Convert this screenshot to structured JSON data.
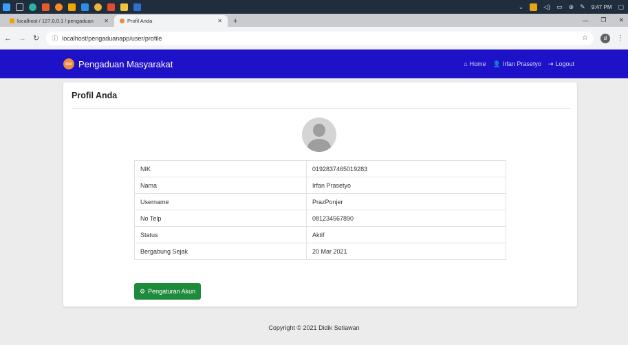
{
  "taskbar": {
    "time": "9:47 PM",
    "icons": [
      "windows-icon",
      "task-view-icon",
      "edge-icon",
      "app-icon",
      "firefox-icon",
      "xampp-icon",
      "vscode-icon",
      "chrome-icon",
      "git-icon",
      "explorer-icon",
      "word-icon"
    ],
    "tray": [
      "chevron-up-icon",
      "app-tray-icon",
      "volume-icon",
      "battery-icon",
      "network-icon",
      "pen-icon"
    ]
  },
  "browser": {
    "tabs": [
      {
        "title": "localhost / 127.0.0.1 / pengaduan",
        "active": false
      },
      {
        "title": "Profil Anda",
        "active": true
      }
    ],
    "url": "localhost/pengaduanapp/user/profile",
    "profile_initial": "d"
  },
  "navbar": {
    "brand": "Pengaduan Masyarakat",
    "links": {
      "home": "Home",
      "user": "Irfan Prasetyo",
      "logout": "Logout"
    },
    "colors": {
      "bg": "#1d12c7"
    }
  },
  "profile": {
    "title": "Profil Anda",
    "rows": [
      {
        "label": "NIK",
        "value": "0192837465019283"
      },
      {
        "label": "Nama",
        "value": "Irfan Prasetyo"
      },
      {
        "label": "Username",
        "value": "PrazPonjer"
      },
      {
        "label": "No Telp",
        "value": "081234567890"
      },
      {
        "label": "Status",
        "value": "Aktif"
      },
      {
        "label": "Bergabung Sejak",
        "value": "20 Mar 2021"
      }
    ],
    "settings_button": "Pengaturan Akun"
  },
  "footer": {
    "copyright": "Copyright © 2021 Didik Setiawan"
  }
}
